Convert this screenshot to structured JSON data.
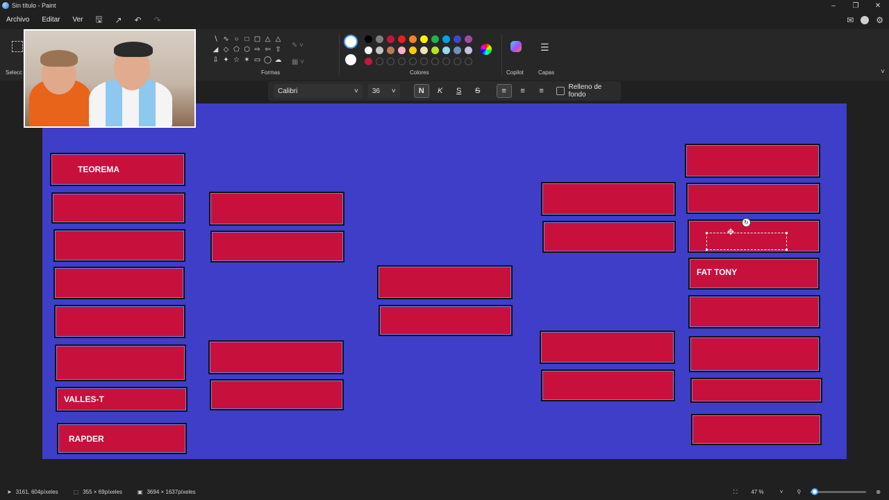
{
  "window": {
    "title": "Sin título - Paint"
  },
  "menu": {
    "file": "Archivo",
    "edit": "Editar",
    "view": "Ver"
  },
  "ribbon": {
    "selection_label": "Selecc",
    "shapes_label": "Formas",
    "colors_label": "Colores",
    "copilot_label": "Copilot",
    "layers_label": "Capas",
    "primary_color": "#ffffff",
    "secondary_color": "#ffffff",
    "palette_row1": [
      "#000000",
      "#7f7f7f",
      "#c3173f",
      "#ed1c24",
      "#ff7f27",
      "#fff200",
      "#22b14c",
      "#00a2e8",
      "#3f48cc",
      "#a349a4"
    ],
    "palette_row2": [
      "#ffffff",
      "#c3c3c3",
      "#b97a57",
      "#ffaec9",
      "#ffc90e",
      "#efe4b0",
      "#b5e61d",
      "#99d9ea",
      "#7092be",
      "#c8bfe7"
    ],
    "palette_row3_first": "#c3173f"
  },
  "text_toolbar": {
    "font": "Calibri",
    "size": "36",
    "bold": "N",
    "italic": "K",
    "underline": "S",
    "strike": "S",
    "fill_background": "Relleno de fondo"
  },
  "canvas": {
    "background": "#3e3ec8",
    "box_color": "#c8103d",
    "labels": {
      "teorema": "TEOREMA",
      "valles": "VALLES-T",
      "rapder": "RAPDER",
      "fat_tony": "FAT TONY"
    }
  },
  "status": {
    "cursor": "3161, 604píxeles",
    "selection": "355 × 69píxeles",
    "image_size": "3694 × 1637píxeles",
    "zoom": "47 %",
    "zoom_fraction": 0.05
  }
}
